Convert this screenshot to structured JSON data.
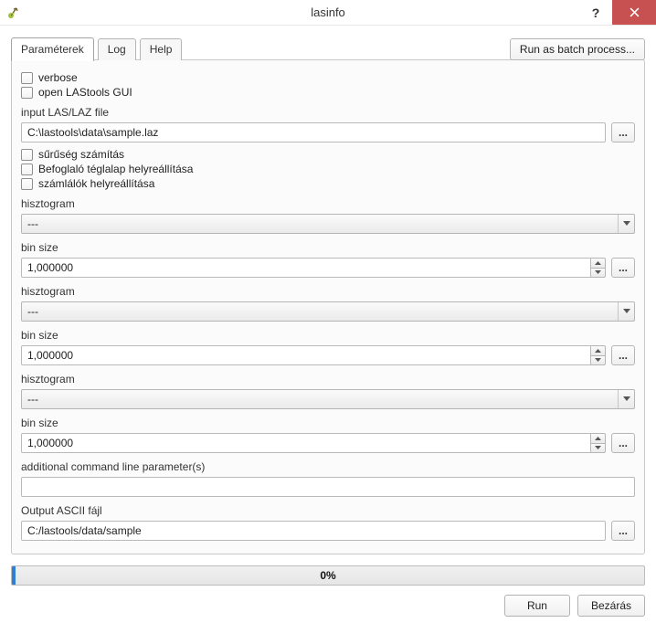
{
  "window": {
    "title": "lasinfo"
  },
  "toolbar": {
    "batch_label": "Run as batch process..."
  },
  "tabs": {
    "parameters": "Paraméterek",
    "log": "Log",
    "help": "Help"
  },
  "params": {
    "verbose": "verbose",
    "open_gui": "open LAStools GUI",
    "input_label": "input LAS/LAZ file",
    "input_value": "C:\\lastools\\data\\sample.laz",
    "density": "sűrűség számítás",
    "bbox_repair": "Befoglaló téglalap helyreállítása",
    "counters_repair": "számlálók helyreállítása",
    "histogram_label": "hisztogram",
    "histogram_value": "---",
    "binsize_label": "bin size",
    "binsize_value": "1,000000",
    "additional_label": "additional command line parameter(s)",
    "additional_value": "",
    "output_label": "Output ASCII fájl",
    "output_value": "C:/lastools/data/sample"
  },
  "progress": {
    "label": "0%"
  },
  "footer": {
    "run": "Run",
    "close": "Bezárás"
  },
  "icons": {
    "dots": "..."
  }
}
